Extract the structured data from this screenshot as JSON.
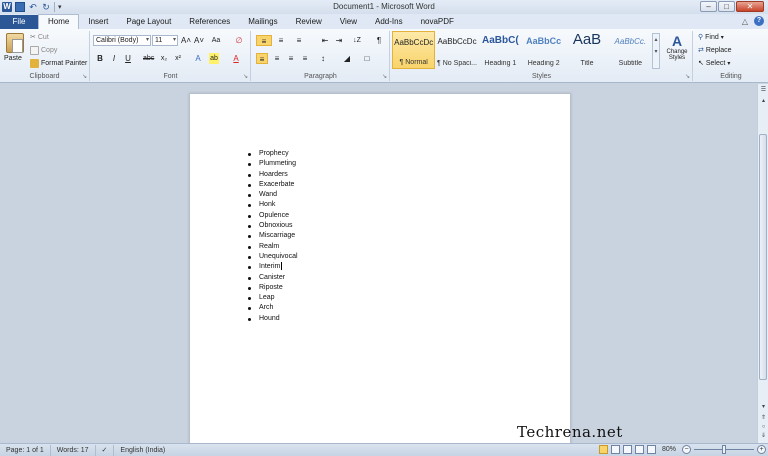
{
  "window": {
    "title": "Document1  -  Microsoft Word",
    "minimize": "–",
    "maximize": "□",
    "close": "✕"
  },
  "quick_access": {
    "logo": "W",
    "undo": "↶",
    "redo": "↻",
    "customize": "▾"
  },
  "tabs": [
    "File",
    "Home",
    "Insert",
    "Page Layout",
    "References",
    "Mailings",
    "Review",
    "View",
    "Add-Ins",
    "novaPDF"
  ],
  "ribbon": {
    "clipboard": {
      "label": "Clipboard",
      "paste": "Paste",
      "cut": "Cut",
      "copy": "Copy",
      "format_painter": "Format Painter"
    },
    "font": {
      "label": "Font",
      "font_name": "Calibri (Body)",
      "font_size": "11",
      "grow": "A˄",
      "shrink": "A˅",
      "change_case": "Aa",
      "clear": "∅",
      "bold": "B",
      "italic": "I",
      "underline": "U",
      "strike": "abc",
      "subscript": "x₂",
      "superscript": "x²",
      "effects": "A",
      "highlight": "ab",
      "color": "A"
    },
    "paragraph": {
      "label": "Paragraph",
      "show_marks": "¶",
      "sort": "↓Z"
    },
    "styles": {
      "label": "Styles",
      "items": [
        {
          "preview": "AaBbCcDc",
          "name": "¶ Normal"
        },
        {
          "preview": "AaBbCcDc",
          "name": "¶ No Spaci..."
        },
        {
          "preview": "AaBbC(",
          "name": "Heading 1"
        },
        {
          "preview": "AaBbCc",
          "name": "Heading 2"
        },
        {
          "preview": "AaB",
          "name": "Title"
        },
        {
          "preview": "AaBbCc.",
          "name": "Subtitle"
        }
      ],
      "change_styles": "Change Styles"
    },
    "editing": {
      "label": "Editing",
      "find": "Find",
      "replace": "Replace",
      "select": "Select"
    }
  },
  "document": {
    "bullets": [
      "Prophecy",
      "Plummeting",
      "Hoarders",
      "Exacerbate",
      "Wand",
      "Honk",
      "Opulence",
      "Obnoxious",
      "Miscarriage",
      "Realm",
      "Unequivocal",
      "Interim",
      "Canister",
      "Riposte",
      "Leap",
      "Arch",
      "Hound"
    ],
    "caret_after_index": 11,
    "watermark": "Techrena.net"
  },
  "status": {
    "page": "Page: 1 of 1",
    "words": "Words: 17",
    "language": "English (India)",
    "zoom": "80%",
    "zoom_fraction": 0.5
  },
  "colors": {
    "file_tab": "#2b5797",
    "selected_style": "#f9d46b"
  }
}
